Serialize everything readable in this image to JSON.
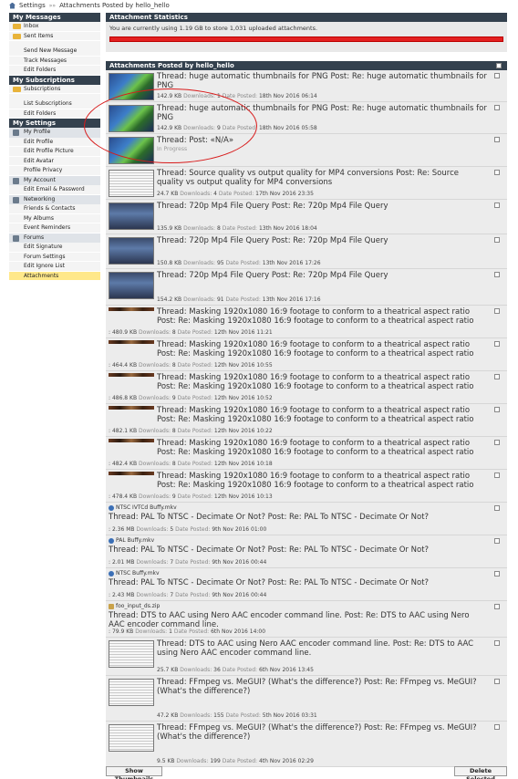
{
  "breadcrumb": {
    "root": "Settings",
    "separator": "»»",
    "current": "Attachments Posted by hello_hello"
  },
  "sidebar": {
    "messages": {
      "header": "My Messages",
      "items": [
        "Inbox",
        "Sent Items",
        "Send New Message",
        "Track Messages",
        "Edit Folders"
      ]
    },
    "subscriptions": {
      "header": "My Subscriptions",
      "items": [
        "Subscriptions",
        "List Subscriptions",
        "Edit Folders"
      ]
    },
    "settings": {
      "header": "My Settings",
      "groups": [
        {
          "label": "My Profile",
          "items": [
            "Edit Profile",
            "Edit Profile Picture",
            "Edit Avatar",
            "Profile Privacy"
          ]
        },
        {
          "label": "My Account",
          "items": [
            "Edit Email & Password"
          ]
        },
        {
          "label": "Networking",
          "items": [
            "Friends & Contacts",
            "My Albums",
            "Event Reminders"
          ]
        },
        {
          "label": "Forums",
          "items": [
            "Edit Signature",
            "Forum Settings",
            "Edit Ignore List",
            "Attachments"
          ]
        }
      ]
    }
  },
  "stats": {
    "header": "Attachment Statistics",
    "text": "You are currently using 1.19 GB to store 1,031 uploaded attachments.",
    "quota_fill": 1.0,
    "bar_color": "#e32020"
  },
  "list_header": "Attachments Posted by hello_hello",
  "labels": {
    "downloads": "Downloads:",
    "date": "Date Posted:"
  },
  "rows": [
    {
      "title": "Thread: huge automatic thumbnails for PNG Post: Re: huge automatic thumbnails for PNG",
      "size": "142.9 KB",
      "downloads": "1",
      "date": "18th Nov 2016 06:14"
    },
    {
      "title": "Thread: huge automatic thumbnails for PNG Post: Re: huge automatic thumbnails for PNG",
      "size": "142.9 KB",
      "downloads": "9",
      "date": "18th Nov 2016 05:58"
    },
    {
      "title": "Thread: Post: «N/A»",
      "status": "In Progress"
    },
    {
      "title": "Thread: Source quality vs output quality for MP4 conversions Post: Re: Source quality vs output quality for MP4 conversions",
      "size": "24.7 KB",
      "downloads": "4",
      "date": "17th Nov 2016 23:35"
    },
    {
      "title": "Thread: 720p Mp4 File Query Post: Re: 720p Mp4 File Query",
      "size": "135.9 KB",
      "downloads": "8",
      "date": "13th Nov 2016 18:04"
    },
    {
      "title": "Thread: 720p Mp4 File Query Post: Re: 720p Mp4 File Query",
      "size": "150.8 KB",
      "downloads": "95",
      "date": "13th Nov 2016 17:26"
    },
    {
      "title": "Thread: 720p Mp4 File Query Post: Re: 720p Mp4 File Query",
      "size": "154.2 KB",
      "downloads": "91",
      "date": "13th Nov 2016 17:16"
    },
    {
      "title": "Thread: Masking 1920x1080 16:9 footage to conform to a theatrical aspect ratio Post: Re: Masking 1920x1080 16:9 footage to conform to a theatrical aspect ratio",
      "size": "480.9 KB",
      "downloads": "8",
      "date": "12th Nov 2016 11:21"
    },
    {
      "title": "Thread: Masking 1920x1080 16:9 footage to conform to a theatrical aspect ratio Post: Re: Masking 1920x1080 16:9 footage to conform to a theatrical aspect ratio",
      "size": "464.4 KB",
      "downloads": "8",
      "date": "12th Nov 2016 10:55"
    },
    {
      "title": "Thread: Masking 1920x1080 16:9 footage to conform to a theatrical aspect ratio Post: Re: Masking 1920x1080 16:9 footage to conform to a theatrical aspect ratio",
      "size": "486.8 KB",
      "downloads": "9",
      "date": "12th Nov 2016 10:52"
    },
    {
      "title": "Thread: Masking 1920x1080 16:9 footage to conform to a theatrical aspect ratio Post: Re: Masking 1920x1080 16:9 footage to conform to a theatrical aspect ratio",
      "size": "482.1 KB",
      "downloads": "8",
      "date": "12th Nov 2016 10:22"
    },
    {
      "title": "Thread: Masking 1920x1080 16:9 footage to conform to a theatrical aspect ratio Post: Re: Masking 1920x1080 16:9 footage to conform to a theatrical aspect ratio",
      "size": "482.4 KB",
      "downloads": "8",
      "date": "12th Nov 2016 10:18"
    },
    {
      "title": "Thread: Masking 1920x1080 16:9 footage to conform to a theatrical aspect ratio Post: Re: Masking 1920x1080 16:9 footage to conform to a theatrical aspect ratio",
      "size": "478.4 KB",
      "downloads": "9",
      "date": "12th Nov 2016 10:13"
    },
    {
      "file": "NTSC IVTCd Buffy.mkv",
      "title": "Thread: PAL To NTSC - Decimate Or Not? Post: Re: PAL To NTSC - Decimate Or Not?",
      "size": "2.36 MB",
      "downloads": "5",
      "date": "9th Nov 2016 01:00"
    },
    {
      "file": "PAL Buffy.mkv",
      "title": "Thread: PAL To NTSC - Decimate Or Not? Post: Re: PAL To NTSC - Decimate Or Not?",
      "size": "2.01 MB",
      "downloads": "7",
      "date": "9th Nov 2016 00:44"
    },
    {
      "file": "NTSC Buffy.mkv",
      "title": "Thread: PAL To NTSC - Decimate Or Not? Post: Re: PAL To NTSC - Decimate Or Not?",
      "size": "2.43 MB",
      "downloads": "7",
      "date": "9th Nov 2016 00:44"
    },
    {
      "file": "foo_input_ds.zip",
      "title": "Thread: DTS to AAC using Nero AAC encoder command line. Post: Re: DTS to AAC using Nero AAC encoder command line.",
      "size": "79.9 KB",
      "downloads": "1",
      "date": "6th Nov 2016 14:00"
    },
    {
      "title": "Thread: DTS to AAC using Nero AAC encoder command line. Post: Re: DTS to AAC using Nero AAC encoder command line.",
      "size": "25.7 KB",
      "downloads": "36",
      "date": "6th Nov 2016 13:45"
    },
    {
      "title": "Thread: FFmpeg vs. MeGUI? (What's the difference?) Post: Re: FFmpeg vs. MeGUI? (What's the difference?)",
      "size": "47.2 KB",
      "downloads": "155",
      "date": "5th Nov 2016 03:31"
    },
    {
      "title": "Thread: FFmpeg vs. MeGUI? (What's the difference?) Post: Re: FFmpeg vs. MeGUI? (What's the difference?)",
      "size": "9.5 KB",
      "downloads": "199",
      "date": "4th Nov 2016 02:29"
    }
  ],
  "buttons": {
    "show_thumbnails": "Show Thumbnails",
    "delete_selected": "Delete Selected"
  },
  "colors": {
    "header_bg": "#34414e",
    "row_bg": "#ececec",
    "active_item": "#ffe88a",
    "annotation": "#d81b1b"
  }
}
